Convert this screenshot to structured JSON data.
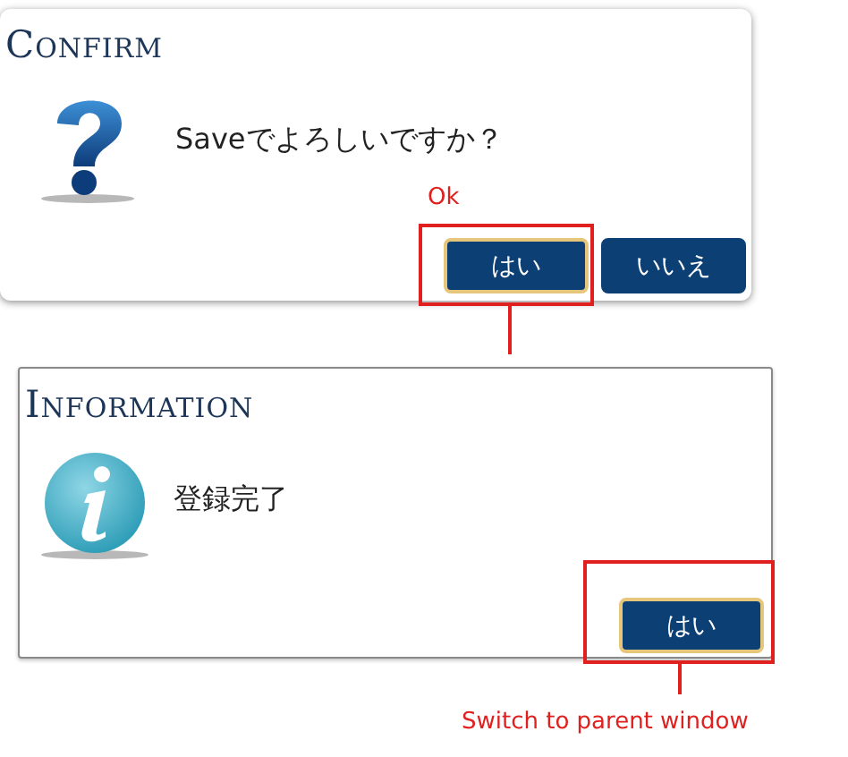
{
  "dialogs": [
    {
      "kind": "confirm",
      "title": "Confirm",
      "message": "Saveでよろしいですか？",
      "buttons": [
        {
          "label": "はい",
          "focused": true
        },
        {
          "label": "いいえ",
          "focused": false
        }
      ]
    },
    {
      "kind": "information",
      "title": "Information",
      "message": "登録完了",
      "buttons": [
        {
          "label": "はい",
          "focused": true
        }
      ]
    }
  ],
  "annotations": [
    {
      "text": "Ok"
    },
    {
      "text": "Switch to parent window"
    }
  ]
}
